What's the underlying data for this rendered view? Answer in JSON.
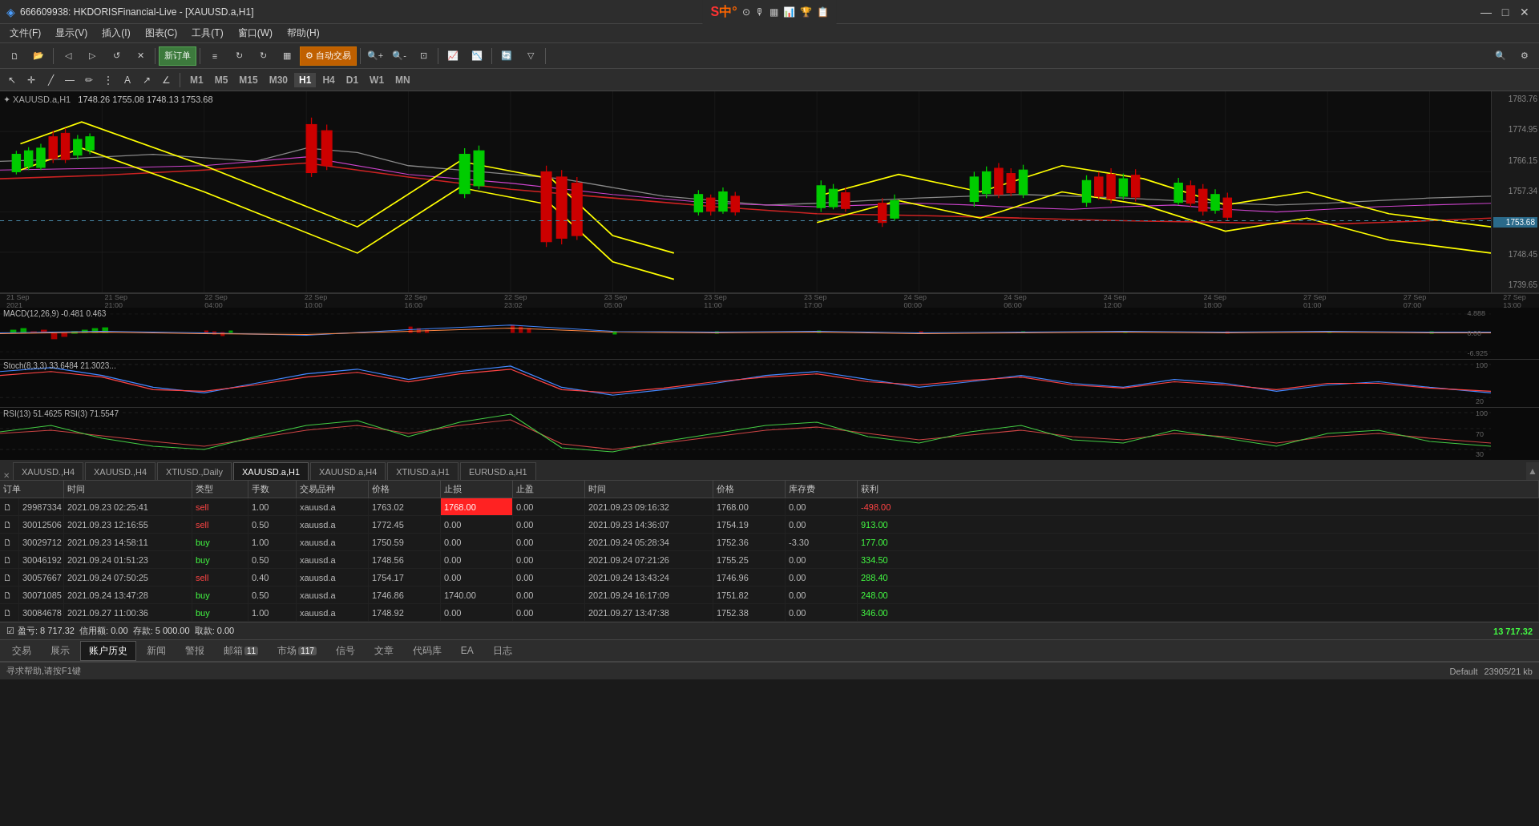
{
  "window": {
    "title": "666609938: HKDORISFinancial-Live - [XAUUSD.a,H1]",
    "minimize": "—",
    "maximize": "□",
    "close": "✕"
  },
  "logo": {
    "brand": "S中°",
    "icons": [
      "◎",
      "⊕",
      "▣",
      "📊",
      "⬆",
      "📋"
    ]
  },
  "menu": {
    "items": [
      "文件(F)",
      "显示(V)",
      "插入(I)",
      "图表(C)",
      "工具(T)",
      "窗口(W)",
      "帮助(H)"
    ]
  },
  "toolbar": {
    "new_order": "新订单",
    "auto_trade": "自动交易"
  },
  "timeframes": {
    "periods": [
      "M1",
      "M5",
      "M15",
      "M30",
      "H1",
      "H4",
      "D1",
      "W1",
      "MN"
    ],
    "active": "H1"
  },
  "chart": {
    "symbol": "XAUUSD.a,H1",
    "prices": [
      "1748.26",
      "1755.08",
      "1748.13",
      "1753.68"
    ],
    "price_labels": [
      "1783.76",
      "1774.95",
      "1766.15",
      "1757.34",
      "1753.68",
      "1748.45",
      "1739.65"
    ],
    "current_price": "1753.68",
    "time_labels": [
      "21 Sep 2021",
      "21 Sep 21:00",
      "22 Sep 04:00",
      "22 Sep 10:00",
      "22 Sep 16:00",
      "22 Sep 23:02",
      "23 Sep 05:00",
      "23 Sep 11:00",
      "23 Sep 17:00",
      "24 Sep 00:00",
      "24 Sep 06:00",
      "24 Sep 12:00",
      "24 Sep 18:00",
      "27 Sep 01:00",
      "27 Sep 07:00",
      "27 Sep 13:00"
    ]
  },
  "indicators": {
    "macd": {
      "label": "MACD(12,26,9) -0.481 0.463",
      "right_labels": [
        "4.888",
        "0.00",
        "-6.925"
      ]
    },
    "stoch": {
      "label": "Stoch(8,3,3) 33.6484 21.3023...",
      "right_labels": [
        "100",
        "20"
      ]
    },
    "rsi": {
      "label": "RSI(13) 51.4625  RSI(3) 71.5547",
      "right_labels": [
        "100",
        "70",
        "30"
      ]
    }
  },
  "chart_tabs": {
    "items": [
      {
        "label": "XAUUSD.,H4",
        "active": false
      },
      {
        "label": "XAUUSD.,H4",
        "active": false
      },
      {
        "label": "XTIUSD.,Daily",
        "active": false
      },
      {
        "label": "XAUUSD.a,H1",
        "active": true
      },
      {
        "label": "XAUUSD.a,H4",
        "active": false
      },
      {
        "label": "XTIUSD.a,H1",
        "active": false
      },
      {
        "label": "EURUSD.a,H1",
        "active": false
      }
    ]
  },
  "orders": {
    "headers": [
      "订单",
      "时间",
      "类型",
      "手数",
      "交易品种",
      "价格",
      "止损",
      "止盈",
      "时间",
      "价格",
      "库存费",
      "获利"
    ],
    "rows": [
      {
        "id": "29987334",
        "time": "2021.09.23 02:25:41",
        "type": "sell",
        "lot": "1.00",
        "symbol": "xauusd.a",
        "price": "1763.02",
        "sl": "1768.00",
        "tp": "0.00",
        "close_time": "2021.09.23 09:16:32",
        "close_price": "1768.00",
        "swap": "0.00",
        "profit": "-498.00",
        "sl_highlighted": true
      },
      {
        "id": "30012506",
        "time": "2021.09.23 12:16:55",
        "type": "sell",
        "lot": "0.50",
        "symbol": "xauusd.a",
        "price": "1772.45",
        "sl": "0.00",
        "tp": "0.00",
        "close_time": "2021.09.23 14:36:07",
        "close_price": "1754.19",
        "swap": "0.00",
        "profit": "913.00"
      },
      {
        "id": "30029712",
        "time": "2021.09.23 14:58:11",
        "type": "buy",
        "lot": "1.00",
        "symbol": "xauusd.a",
        "price": "1750.59",
        "sl": "0.00",
        "tp": "0.00",
        "close_time": "2021.09.24 05:28:34",
        "close_price": "1752.36",
        "swap": "-3.30",
        "profit": "177.00"
      },
      {
        "id": "30046192",
        "time": "2021.09.24 01:51:23",
        "type": "buy",
        "lot": "0.50",
        "symbol": "xauusd.a",
        "price": "1748.56",
        "sl": "0.00",
        "tp": "0.00",
        "close_time": "2021.09.24 07:21:26",
        "close_price": "1755.25",
        "swap": "0.00",
        "profit": "334.50"
      },
      {
        "id": "30057667",
        "time": "2021.09.24 07:50:25",
        "type": "sell",
        "lot": "0.40",
        "symbol": "xauusd.a",
        "price": "1754.17",
        "sl": "0.00",
        "tp": "0.00",
        "close_time": "2021.09.24 13:43:24",
        "close_price": "1746.96",
        "swap": "0.00",
        "profit": "288.40"
      },
      {
        "id": "30071085",
        "time": "2021.09.24 13:47:28",
        "type": "buy",
        "lot": "0.50",
        "symbol": "xauusd.a",
        "price": "1746.86",
        "sl": "1740.00",
        "tp": "0.00",
        "close_time": "2021.09.24 16:17:09",
        "close_price": "1751.82",
        "swap": "0.00",
        "profit": "248.00"
      },
      {
        "id": "30084678",
        "time": "2021.09.27 11:00:36",
        "type": "buy",
        "lot": "1.00",
        "symbol": "xauusd.a",
        "price": "1748.92",
        "sl": "0.00",
        "tp": "0.00",
        "close_time": "2021.09.27 13:47:38",
        "close_price": "1752.38",
        "swap": "0.00",
        "profit": "346.00"
      }
    ],
    "balance": "盈亏: 8 717.32  信用额: 0.00  存款: 5 000.00  取款: 0.00",
    "total_profit": "13 717.32"
  },
  "bottom_tabs": {
    "items": [
      {
        "label": "交易",
        "active": false,
        "badge": null
      },
      {
        "label": "展示",
        "active": false,
        "badge": null
      },
      {
        "label": "账户历史",
        "active": true,
        "badge": null
      },
      {
        "label": "新闻",
        "active": false,
        "badge": null
      },
      {
        "label": "警报",
        "active": false,
        "badge": null
      },
      {
        "label": "邮箱",
        "active": false,
        "badge": "11"
      },
      {
        "label": "市场",
        "active": false,
        "badge": "117"
      },
      {
        "label": "信号",
        "active": false,
        "badge": null
      },
      {
        "label": "文章",
        "active": false,
        "badge": null
      },
      {
        "label": "代码库",
        "active": false,
        "badge": null
      },
      {
        "label": "EA",
        "active": false,
        "badge": null
      },
      {
        "label": "日志",
        "active": false,
        "badge": null
      }
    ]
  },
  "status_bar": {
    "help_text": "寻求帮助,请按F1键",
    "profile": "Default",
    "info": "23905/21 kb"
  }
}
